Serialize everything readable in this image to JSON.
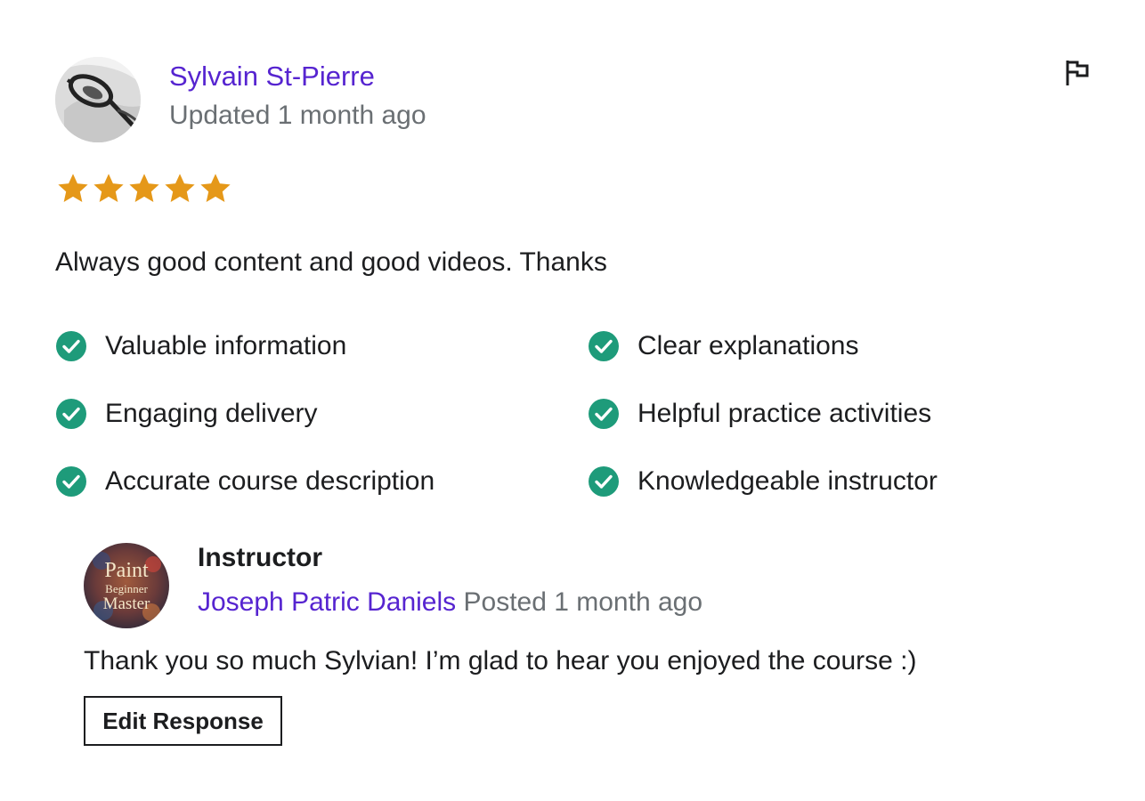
{
  "review": {
    "reviewer_name": "Sylvain St-Pierre",
    "updated_text": "Updated 1 month ago",
    "rating": 5,
    "rating_max": 5,
    "star_color": "#e59819",
    "text": "Always good content and good videos. Thanks",
    "flag_icon": "flag-icon",
    "feedback": [
      {
        "label": "Valuable information",
        "icon": "check-circle-icon"
      },
      {
        "label": "Clear explanations",
        "icon": "check-circle-icon"
      },
      {
        "label": "Engaging delivery",
        "icon": "check-circle-icon"
      },
      {
        "label": "Helpful practice activities",
        "icon": "check-circle-icon"
      },
      {
        "label": "Accurate course description",
        "icon": "check-circle-icon"
      },
      {
        "label": "Knowledgeable instructor",
        "icon": "check-circle-icon"
      }
    ],
    "check_color": "#1e9b7a"
  },
  "response": {
    "role": "Instructor",
    "instructor_name": "Joseph Patric Daniels",
    "posted_text": "Posted 1 month ago",
    "avatar_text": [
      "Paint",
      "Beginner",
      "Master"
    ],
    "text": "Thank you so much Sylvian! I’m glad to hear you enjoyed the course :)",
    "edit_label": "Edit Response"
  },
  "colors": {
    "link": "#5624d0",
    "muted": "#6a6f73",
    "text": "#1c1d1f"
  }
}
